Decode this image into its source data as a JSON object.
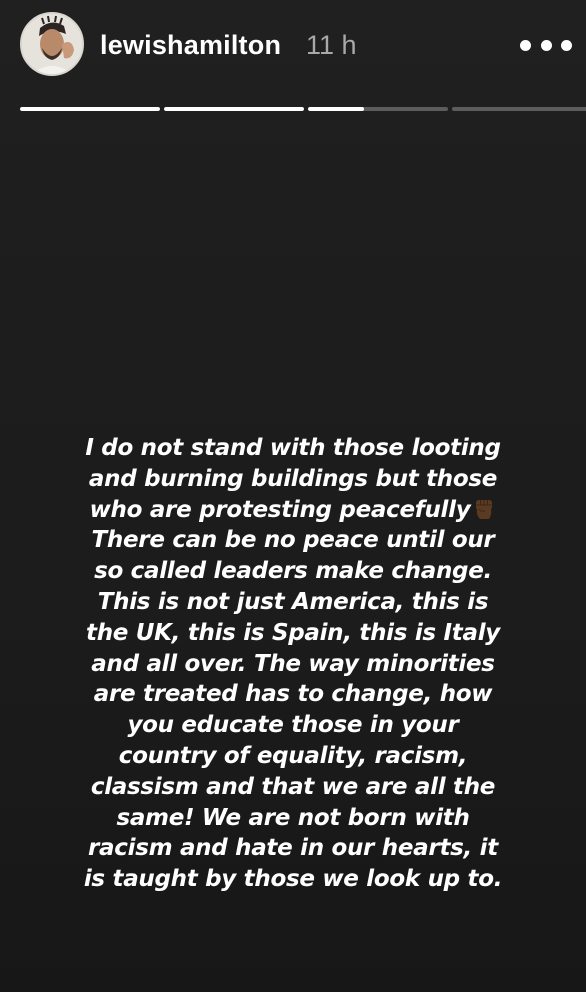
{
  "header": {
    "username": "lewishamilton",
    "timestamp": "11 h",
    "more_icon": "more-horizontal-icon",
    "avatar_icon": "profile-avatar"
  },
  "progress": {
    "segments": [
      {
        "fill": 1.0
      },
      {
        "fill": 1.0
      },
      {
        "fill": 0.4
      },
      {
        "fill": 0.0
      }
    ]
  },
  "story": {
    "lines": [
      "I do not stand with those looting",
      "and burning buildings but those",
      "who are protesting peacefully",
      "There can be no peace until our",
      "so called leaders make change.",
      "This is not just America, this is",
      "the UK, this is Spain, this is Italy",
      "and all over. The way minorities",
      "are treated has to change, how",
      "you educate those in your",
      "country of equality, racism,",
      "classism and that we are all the",
      "same! We are not born with",
      "racism and hate in our hearts, it",
      "is taught by those we look up to."
    ],
    "emoji": "raised-fist-dark-skin-tone-icon",
    "colors": {
      "background": "#1c1c1c",
      "text": "#ffffff",
      "emoji_skin": "#5a3a22"
    }
  }
}
